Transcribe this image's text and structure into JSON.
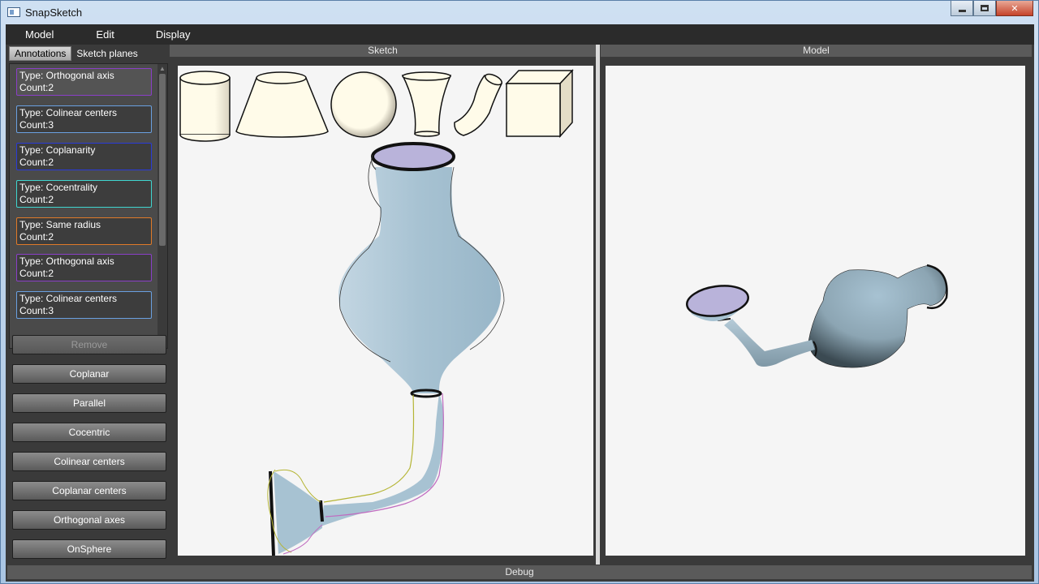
{
  "window": {
    "title": "SnapSketch"
  },
  "menu": [
    "Model",
    "Edit",
    "Display"
  ],
  "tabs": {
    "annotations": "Annotations",
    "sketch_planes": "Sketch planes"
  },
  "annotations": [
    {
      "type": "Type:  Orthogonal axis",
      "count": "Count:2",
      "color": "#8a3fc7"
    },
    {
      "type": "Type:  Colinear centers",
      "count": "Count:3",
      "color": "#6aa0e0"
    },
    {
      "type": "Type:  Coplanarity",
      "count": "Count:2",
      "color": "#2a3bd8"
    },
    {
      "type": "Type:  Cocentrality",
      "count": "Count:2",
      "color": "#3fd6d0"
    },
    {
      "type": "Type:  Same radius",
      "count": "Count:2",
      "color": "#e07a28"
    },
    {
      "type": "Type:  Orthogonal axis",
      "count": "Count:2",
      "color": "#8a3fc7"
    },
    {
      "type": "Type:  Colinear centers",
      "count": "Count:3",
      "color": "#6aa0e0"
    }
  ],
  "buttons": {
    "remove": "Remove",
    "coplanar": "Coplanar",
    "parallel": "Parallel",
    "cocentric": "Cocentric",
    "colinear_centers": "Colinear centers",
    "coplanar_centers": "Coplanar centers",
    "orthogonal_axes": "Orthogonal axes",
    "onsphere": "OnSphere"
  },
  "panels": {
    "sketch": "Sketch",
    "model": "Model"
  },
  "status": {
    "debug": "Debug"
  },
  "colors": {
    "shape_fill": "#a7c2d2",
    "cap_fill": "#b9b3da",
    "primitive_fill": "#fffbe9"
  },
  "primitives": [
    "cylinder-icon",
    "cone-icon",
    "sphere-icon",
    "hyperboloid-icon",
    "bent-tube-icon",
    "cube-icon"
  ]
}
